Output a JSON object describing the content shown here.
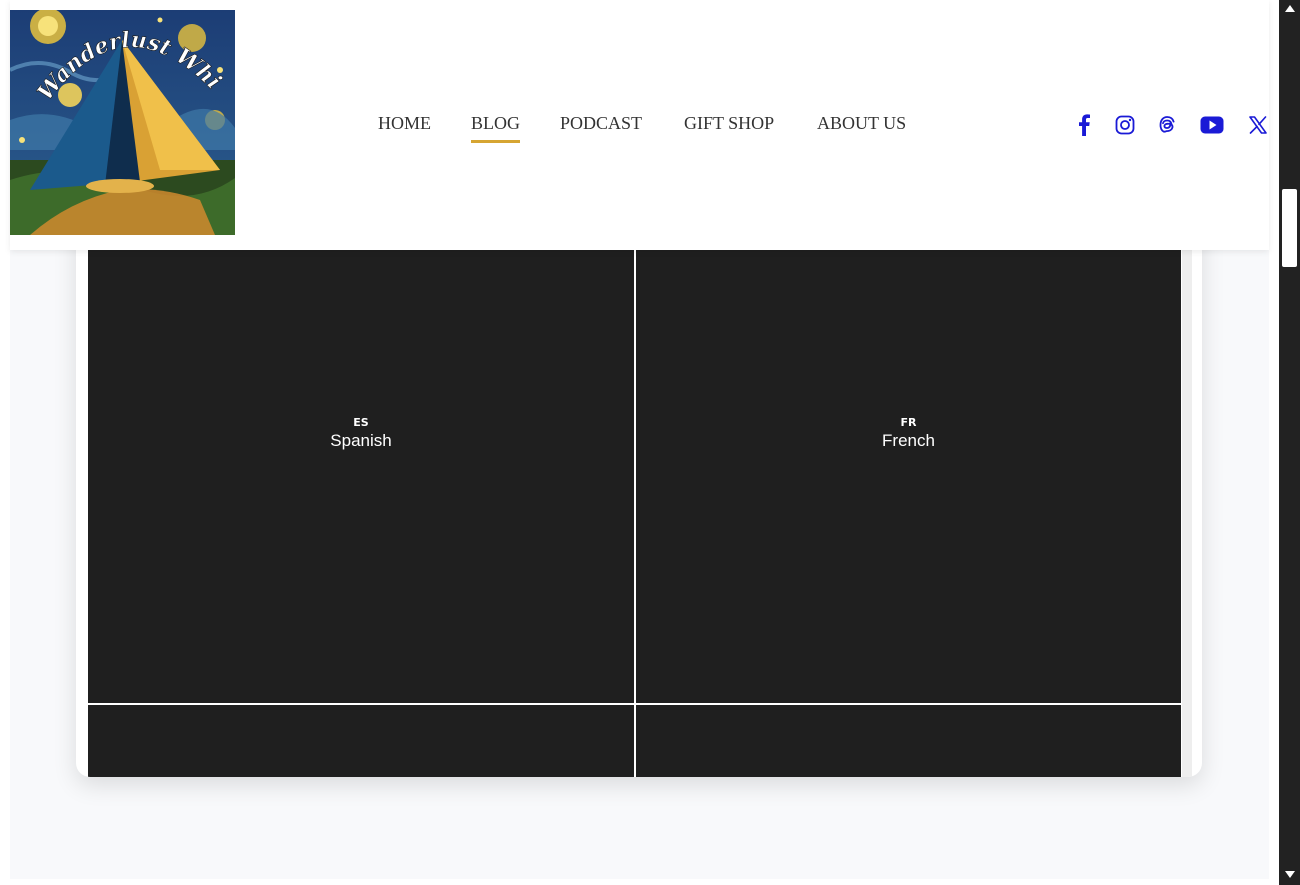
{
  "logo": {
    "text": "Wanderlust Whispers"
  },
  "nav": {
    "items": [
      {
        "label": "HOME"
      },
      {
        "label": "BLOG"
      },
      {
        "label": "PODCAST"
      },
      {
        "label": "GIFT SHOP"
      },
      {
        "label": "ABOUT US"
      }
    ],
    "active_label": "BLOG",
    "accent_color": "#d6a532"
  },
  "socials": {
    "color": "#1a1ad6",
    "icons": [
      "facebook-icon",
      "instagram-icon",
      "threads-icon",
      "youtube-icon",
      "x-icon"
    ]
  },
  "languages": [
    {
      "code": "ES",
      "name": "Spanish"
    },
    {
      "code": "FR",
      "name": "French"
    },
    {
      "code": "",
      "name": ""
    },
    {
      "code": "",
      "name": ""
    }
  ],
  "colors": {
    "tile_bg": "#1f1f1f",
    "page_bg": "#f8f9fb"
  }
}
